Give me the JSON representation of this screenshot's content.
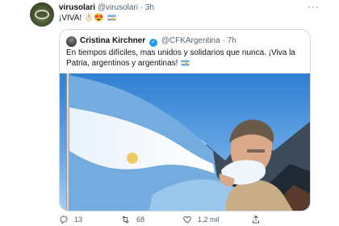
{
  "author": {
    "name": "virusolari",
    "handle": "@virusolari",
    "time": "3h",
    "avatar_icon": "profile-avatar-icon"
  },
  "tweet": {
    "text": "¡VIVA! 👌🏻😍",
    "flag_icon": "argentina-flag-icon"
  },
  "more_icon": "more-options-icon",
  "quoted": {
    "name": "Cristina Kirchner",
    "handle": "@CFKArgentina",
    "time": "7h",
    "verified_icon": "verified-badge-icon",
    "text": "En tiempos difíciles, mas unidos y solidarios que nunca. ¡Viva la Patria, argentinos y argentinas!",
    "flag_icon": "argentina-flag-icon",
    "photo_icon": "man-kissing-argentina-flag-photo"
  },
  "actions": {
    "reply_count": "13",
    "retweet_count": "68",
    "like_count": "1,2 mil",
    "reply_icon": "reply-icon",
    "retweet_icon": "retweet-icon",
    "like_icon": "heart-icon",
    "share_icon": "share-icon"
  },
  "colors": {
    "text": "#0f1419",
    "secondary": "#536471",
    "border": "#cfd9de",
    "verified": "#1d9bf0",
    "flag_blue": "#74acdf"
  }
}
